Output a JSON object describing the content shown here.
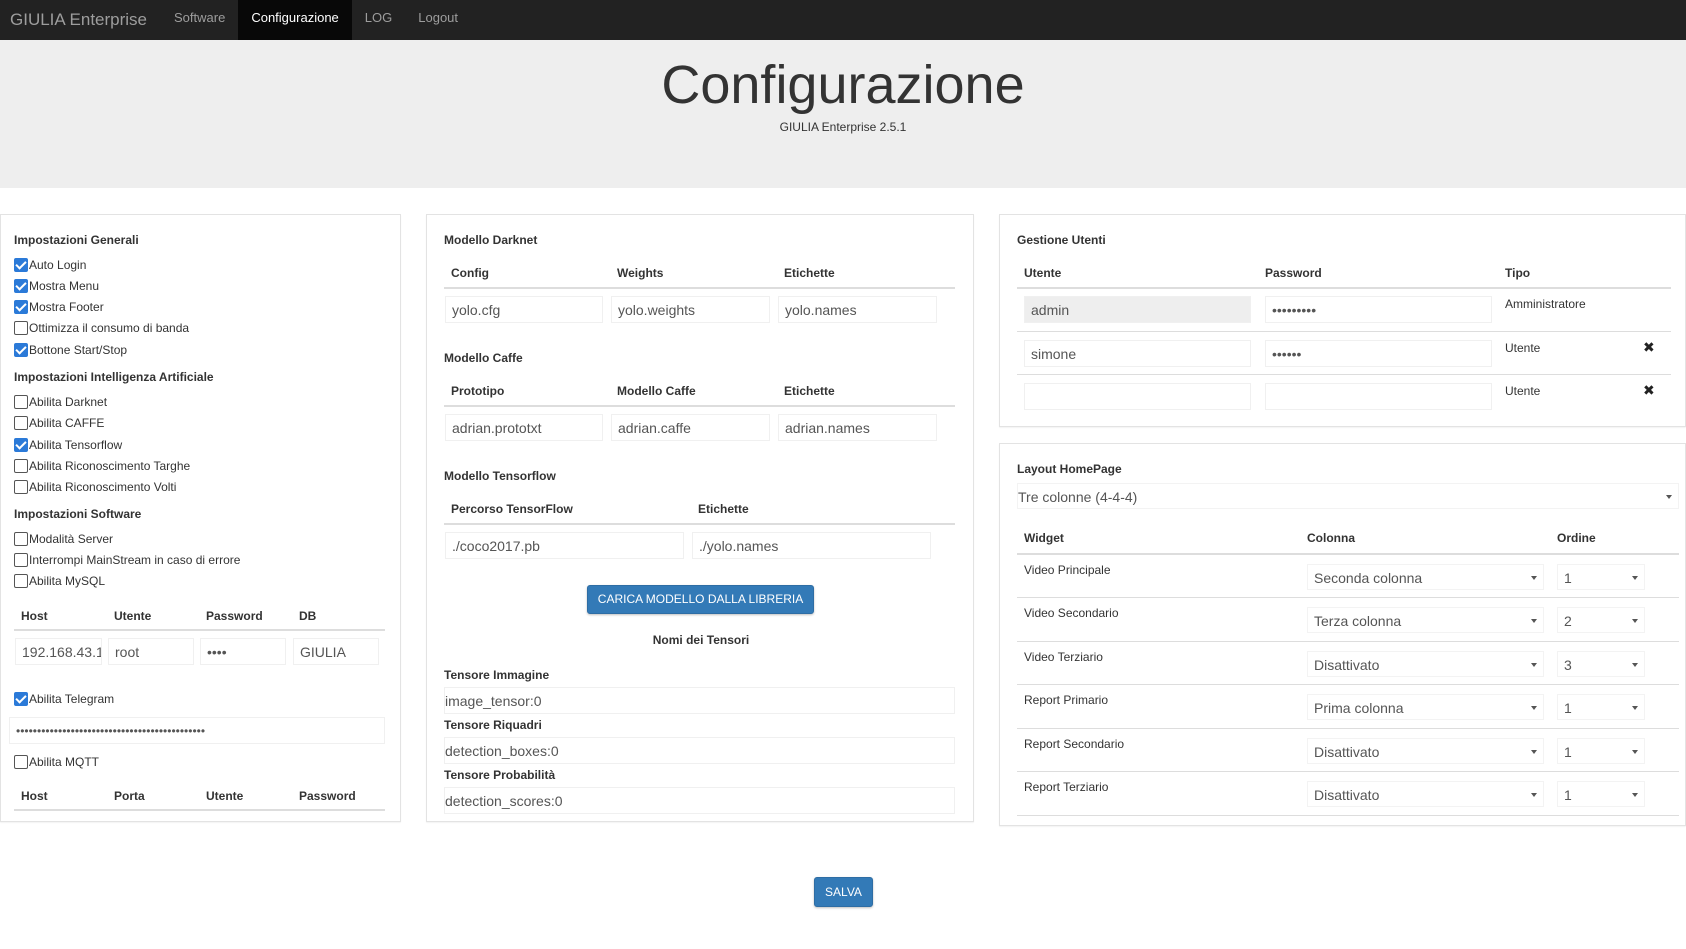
{
  "nav": {
    "brand": "GIULIA Enterprise",
    "links": [
      "Software",
      "Configurazione",
      "LOG",
      "Logout"
    ]
  },
  "header": {
    "title": "Configurazione",
    "version": "GIULIA Enterprise 2.5.1"
  },
  "general": {
    "title": "Impostazioni Generali",
    "items": [
      {
        "label": "Auto Login",
        "checked": true
      },
      {
        "label": "Mostra Menu",
        "checked": true
      },
      {
        "label": "Mostra Footer",
        "checked": true
      },
      {
        "label": "Ottimizza il consumo di banda",
        "checked": false
      },
      {
        "label": "Bottone Start/Stop",
        "checked": true
      }
    ]
  },
  "ai": {
    "title": "Impostazioni Intelligenza Artificiale",
    "items": [
      {
        "label": "Abilita Darknet",
        "checked": false
      },
      {
        "label": "Abilita CAFFE",
        "checked": false
      },
      {
        "label": "Abilita Tensorflow",
        "checked": true
      },
      {
        "label": "Abilita Riconoscimento Targhe",
        "checked": false
      },
      {
        "label": "Abilita Riconoscimento Volti",
        "checked": false
      }
    ]
  },
  "software": {
    "title": "Impostazioni Software",
    "items": [
      {
        "label": "Modalità Server",
        "checked": false
      },
      {
        "label": "Interrompi MainStream in caso di errore",
        "checked": false
      },
      {
        "label": "Abilita MySQL",
        "checked": false
      }
    ],
    "mysql": {
      "headers": [
        "Host",
        "Utente",
        "Password",
        "DB"
      ],
      "values": [
        "192.168.43.1",
        "root",
        "••••",
        "GIULIA"
      ]
    },
    "telegram": {
      "label": "Abilita Telegram",
      "checked": true,
      "token": "•••••••••••••••••••••••••••••••••••••••••••••"
    },
    "mqtt": {
      "label": "Abilita MQTT",
      "checked": false,
      "headers": [
        "Host",
        "Porta",
        "Utente",
        "Password"
      ]
    }
  },
  "darknet": {
    "title": "Modello Darknet",
    "headers": [
      "Config",
      "Weights",
      "Etichette"
    ],
    "values": [
      "yolo.cfg",
      "yolo.weights",
      "yolo.names"
    ]
  },
  "caffe": {
    "title": "Modello Caffe",
    "headers": [
      "Prototipo",
      "Modello Caffe",
      "Etichette"
    ],
    "values": [
      "adrian.prototxt",
      "adrian.caffe",
      "adrian.names"
    ]
  },
  "tensorflow": {
    "title": "Modello Tensorflow",
    "headers": [
      "Percorso TensorFlow",
      "Etichette"
    ],
    "values": [
      "./coco2017.pb",
      "./yolo.names"
    ],
    "load_button": "CARICA MODELLO DALLA LIBRERIA",
    "tensor_names_title": "Nomi dei Tensori",
    "tensors": [
      {
        "label": "Tensore Immagine",
        "value": "image_tensor:0"
      },
      {
        "label": "Tensore Riquadri",
        "value": "detection_boxes:0"
      },
      {
        "label": "Tensore Probabilità",
        "value": "detection_scores:0"
      }
    ]
  },
  "users": {
    "title": "Gestione Utenti",
    "headers": [
      "Utente",
      "Password",
      "Tipo"
    ],
    "rows": [
      {
        "user": "admin",
        "password": "•••••••••",
        "type": "Amministratore",
        "deletable": false
      },
      {
        "user": "simone",
        "password": "••••••",
        "type": "Utente",
        "deletable": true
      },
      {
        "user": "",
        "password": "",
        "type": "Utente",
        "deletable": true
      }
    ]
  },
  "layout": {
    "title": "Layout HomePage",
    "selected": "Tre colonne (4-4-4)",
    "headers": [
      "Widget",
      "Colonna",
      "Ordine"
    ],
    "rows": [
      {
        "widget": "Video Principale",
        "column": "Seconda colonna",
        "order": "1"
      },
      {
        "widget": "Video Secondario",
        "column": "Terza colonna",
        "order": "2"
      },
      {
        "widget": "Video Terziario",
        "column": "Disattivato",
        "order": "3"
      },
      {
        "widget": "Report Primario",
        "column": "Prima colonna",
        "order": "1"
      },
      {
        "widget": "Report Secondario",
        "column": "Disattivato",
        "order": "1"
      },
      {
        "widget": "Report Terziario",
        "column": "Disattivato",
        "order": "1"
      }
    ]
  },
  "save_button": "SALVA",
  "colors": {
    "navbar": "#222222",
    "primary": "#337ab7",
    "checkbox": "#2b7ad8",
    "jumbotron": "#eeeeee"
  }
}
